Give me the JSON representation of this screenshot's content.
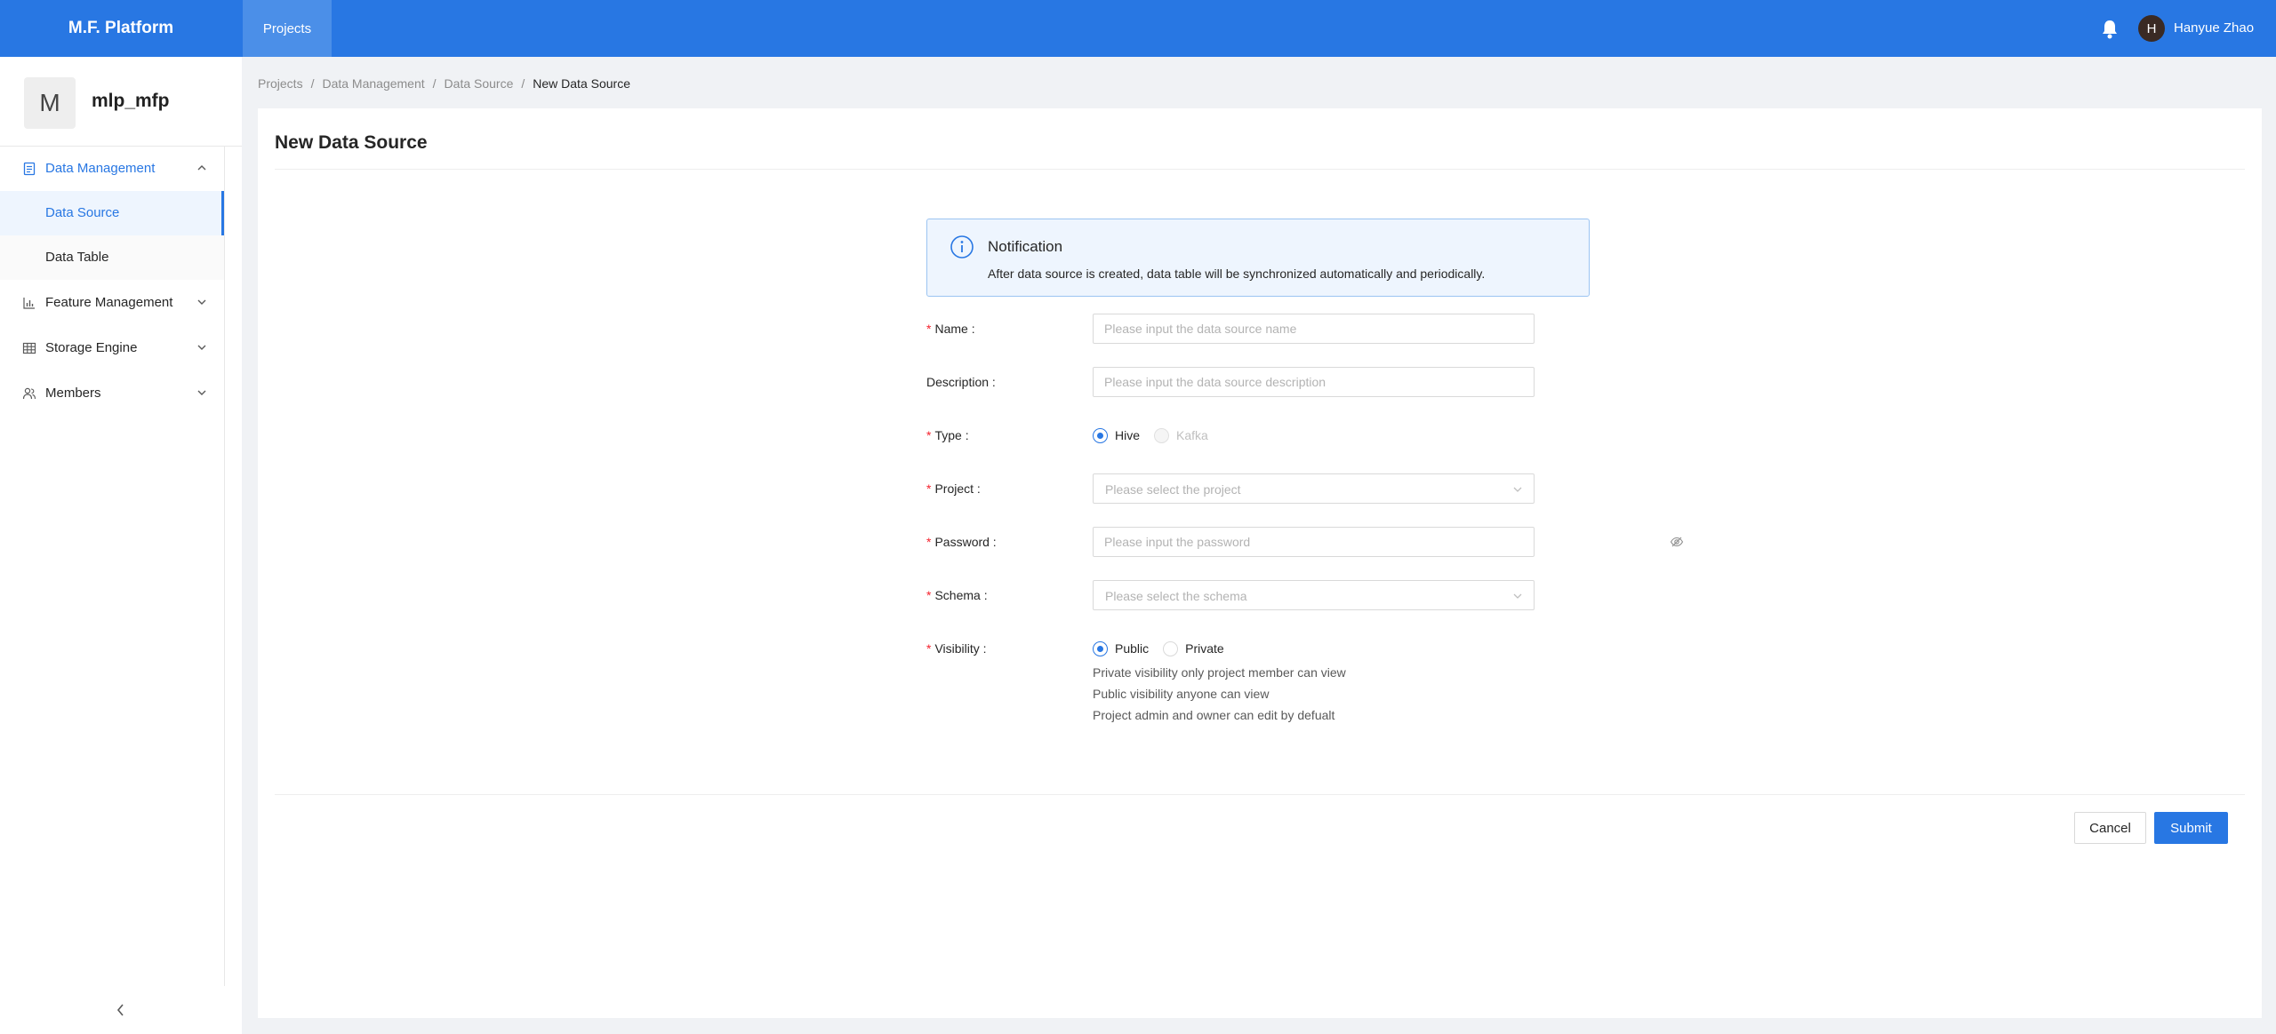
{
  "topbar": {
    "brand": "M.F. Platform",
    "nav_projects": "Projects",
    "avatar_initial": "H",
    "username": "Hanyue Zhao",
    "accent_color": "#2877e3"
  },
  "sidebar": {
    "project_avatar": "M",
    "project_name": "mlp_mfp",
    "data_management": "Data Management",
    "data_source": "Data Source",
    "data_table": "Data Table",
    "feature_management": "Feature Management",
    "storage_engine": "Storage Engine",
    "members": "Members"
  },
  "breadcrumb": {
    "projects": "Projects",
    "data_management": "Data Management",
    "data_source": "Data Source",
    "current": "New Data Source",
    "separator": "/"
  },
  "page": {
    "title": "New Data Source"
  },
  "notice": {
    "title": "Notification",
    "description": "After data source is created, data table will be synchronized automatically and periodically."
  },
  "form": {
    "required_mark": "*",
    "name_label": "Name :",
    "name_placeholder": "Please input the data source name",
    "description_label": "Description :",
    "description_placeholder": "Please input the data source description",
    "type_label": "Type :",
    "type_hive": "Hive",
    "type_kafka": "Kafka",
    "project_label": "Project :",
    "project_placeholder": "Please select the project",
    "password_label": "Password :",
    "password_placeholder": "Please input the password",
    "schema_label": "Schema :",
    "schema_placeholder": "Please select the schema",
    "visibility_label": "Visibility :",
    "visibility_public": "Public",
    "visibility_private": "Private",
    "help_1": "Private visibility only project member can view",
    "help_2": "Public visibility anyone can view",
    "help_3": "Project admin and owner can edit by defualt"
  },
  "actions": {
    "cancel": "Cancel",
    "submit": "Submit"
  }
}
